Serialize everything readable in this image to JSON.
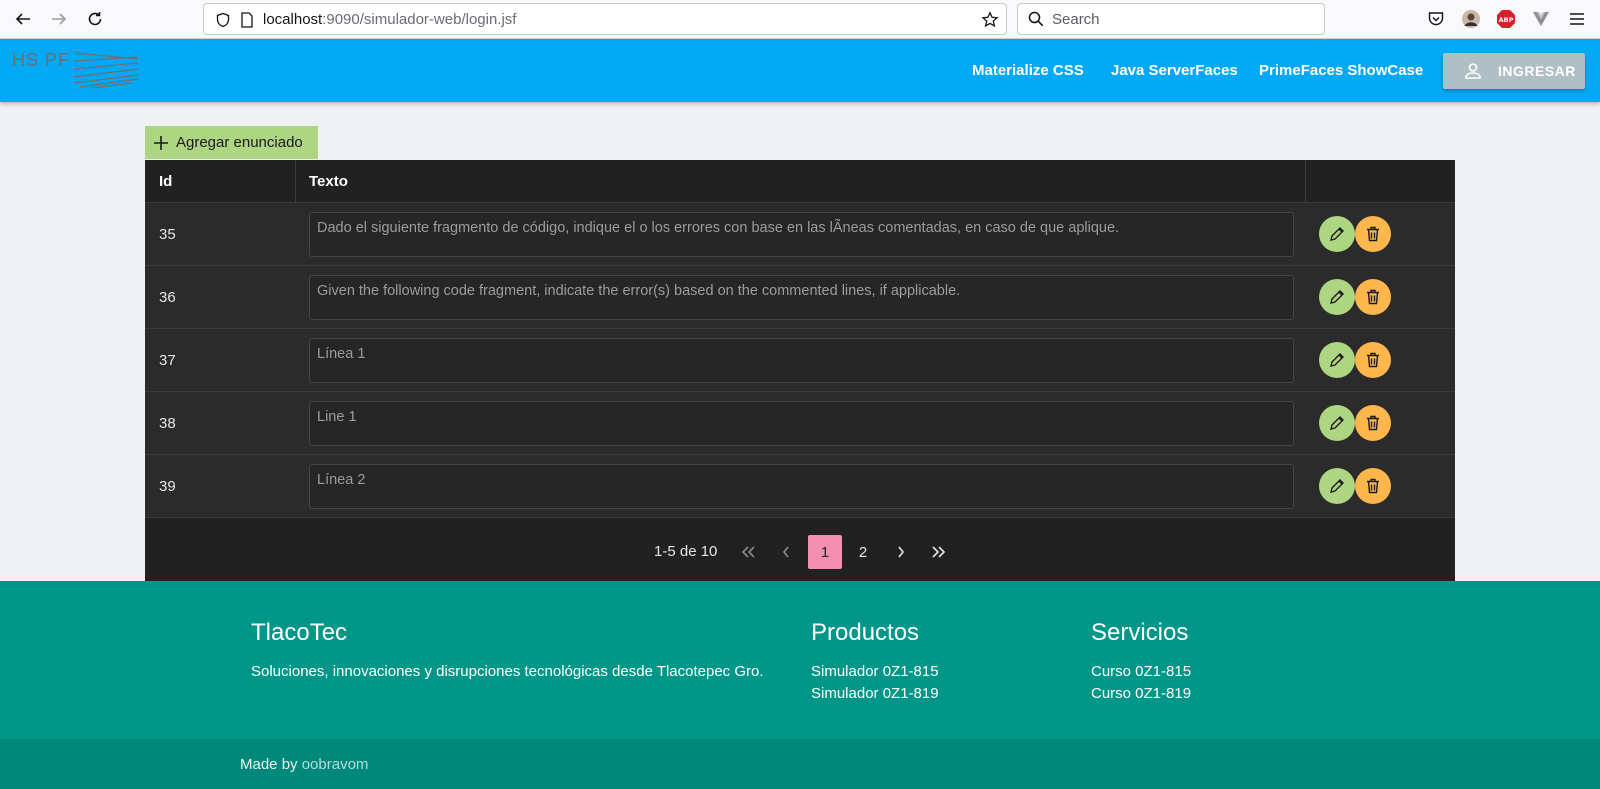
{
  "browser": {
    "url_host": "localhost",
    "url_rest": ":9090/simulador-web/login.jsf",
    "search_placeholder": "Search",
    "abp_label": "ABP"
  },
  "header": {
    "logo_text": "HS PF",
    "nav": [
      "Materialize CSS",
      "Java ServerFaces",
      "PrimeFaces ShowCase"
    ],
    "login_label": "INGRESAR"
  },
  "toolbar": {
    "add_label": "Agregar enunciado"
  },
  "table": {
    "columns": [
      "Id",
      "Texto",
      ""
    ],
    "rows": [
      {
        "id": "35",
        "text": "Dado el siguiente fragmento de código, indique el o los errores con base en las lÃneas comentadas, en caso de que aplique."
      },
      {
        "id": "36",
        "text": "Given the following code fragment, indicate the error(s) based on the commented lines, if applicable."
      },
      {
        "id": "37",
        "text": "Línea 1"
      },
      {
        "id": "38",
        "text": "Line 1"
      },
      {
        "id": "39",
        "text": "Línea 2"
      }
    ]
  },
  "pager": {
    "info": "1-5 de 10",
    "pages": [
      "1",
      "2"
    ],
    "current_page": "1"
  },
  "footer": {
    "brand_title": "TlacoTec",
    "brand_text": "Soluciones, innovaciones y disrupciones tecnológicas desde Tlacotepec Gro.",
    "products_title": "Productos",
    "products": [
      "Simulador 0Z1-815",
      "Simulador 0Z1-819"
    ],
    "services_title": "Servicios",
    "services": [
      "Curso 0Z1-815",
      "Curso 0Z1-819"
    ],
    "made_by_prefix": "Made by",
    "made_by_link": "oobravom"
  },
  "colors": {
    "header": "#03a9f4",
    "add_button": "#aed581",
    "edit_button": "#aed581",
    "delete_button": "#ffb74d",
    "active_page": "#f48fb1",
    "footer": "#009688",
    "footer_bottom": "#00897b",
    "login_button": "#b0bec5"
  }
}
